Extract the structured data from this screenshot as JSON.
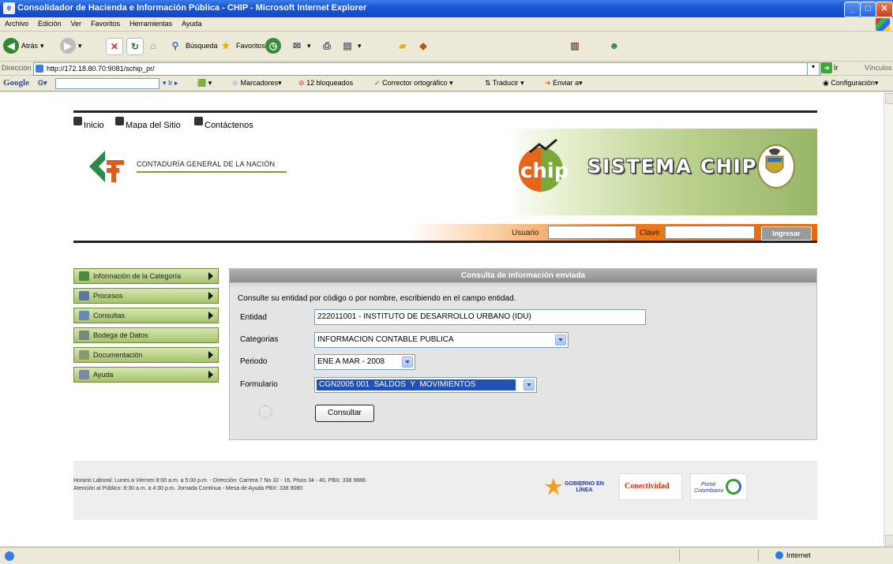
{
  "window": {
    "title": "Consolidador de Hacienda e Información Pública - CHIP - Microsoft Internet Explorer"
  },
  "menu": [
    "Archivo",
    "Edición",
    "Ver",
    "Favoritos",
    "Herramientas",
    "Ayuda"
  ],
  "toolbar": {
    "back_label": "Atrás",
    "search_label": "Búsqueda",
    "favorites_label": "Favoritos"
  },
  "address": {
    "label": "Dirección",
    "url": "http://172.18.80.70:9081/schip_pr/",
    "go_label": "Ir",
    "links_label": "Vínculos"
  },
  "googlebar": {
    "brand": "Google",
    "go": "Ir",
    "bookmarks": "Marcadores",
    "blocked": "12 bloqueados",
    "spell": "Corrector ortográfico",
    "translate": "Traducir",
    "send": "Enviar a",
    "settings": "Configuración"
  },
  "topnav": {
    "home": "Inicio",
    "sitemap": "Mapa del Sitio",
    "contact": "Contáctenos"
  },
  "banner": {
    "org": "CONTADURÍA GENERAL DE LA NACIÓN",
    "system": "SISTEMA CHIP"
  },
  "login": {
    "user_label": "Usuario",
    "password_label": "Clave",
    "submit": "Ingresar"
  },
  "sidemenu": [
    {
      "label": "Información de la Categoría"
    },
    {
      "label": "Procesos"
    },
    {
      "label": "Consultas"
    },
    {
      "label": "Bodega de Datos"
    },
    {
      "label": "Documentación"
    },
    {
      "label": "Ayuda"
    }
  ],
  "form": {
    "heading": "Consulta de información enviada",
    "instructions": "Consulte su entidad por código o por nombre, escribiendo en el campo entidad.",
    "entidad_label": "Entidad",
    "entidad_value": "222011001 - INSTITUTO DE DESARROLLO URBANO (IDU)",
    "categorias_label": "Categorias",
    "categorias_value": "INFORMACION CONTABLE PUBLICA",
    "periodo_label": "Periodo",
    "periodo_value": "ENE A MAR - 2008",
    "formulario_label": "Formulario",
    "formulario_value": "CGN2005 001  SALDOS  Y  MOVIMIENTOS",
    "submit": "Consultar"
  },
  "footer": {
    "line1": "Horario Laboral: Lunes a Viernes 8:00 a.m. a 5:00 p.m. - Dirección: Carrera 7 No 32 - 16, Pisos 34 - 40, PBX: 338 9888.",
    "line2": "Atención al Público: 8:30 a.m. a 4:30 p.m. Jornada Continua - Mesa de Ayuda PBX: 338 9080",
    "logo1": "GOBIERNO EN LÍNEA",
    "logo2": "Conectividad",
    "logo3": "Portal Colombiano"
  },
  "status": {
    "zone": "Internet"
  }
}
